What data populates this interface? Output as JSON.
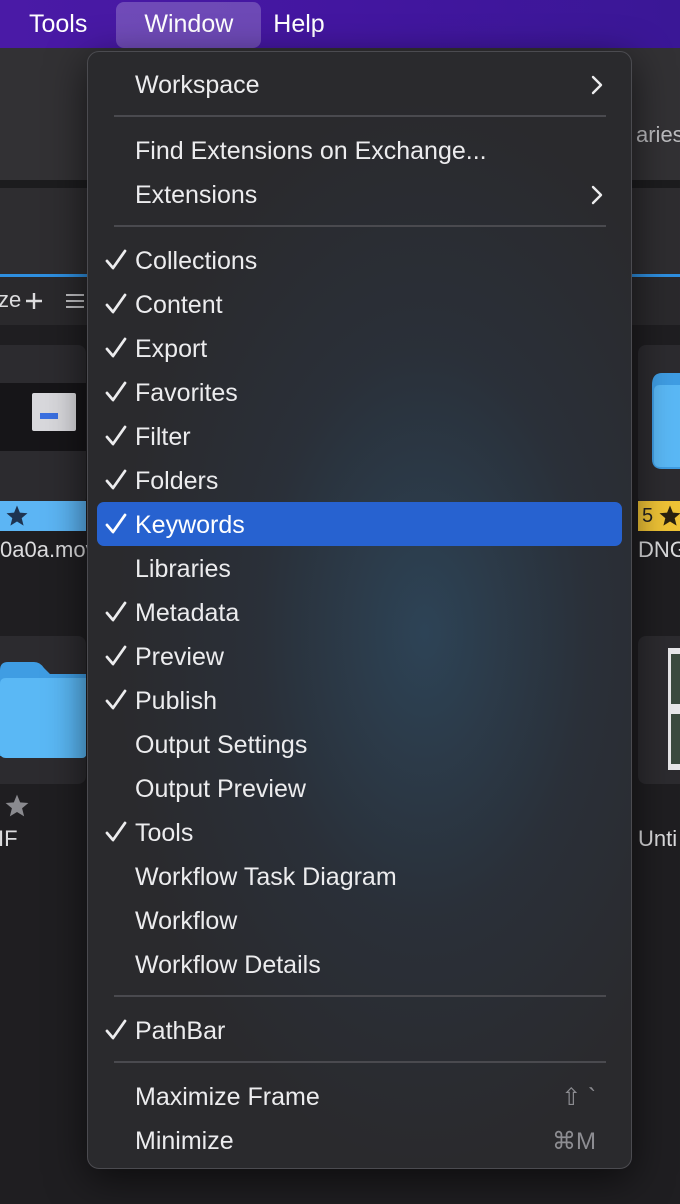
{
  "menubar": {
    "items": [
      "Tools",
      "Window",
      "Help"
    ],
    "active": "Window"
  },
  "background": {
    "toolbar_fragment": "aries",
    "panel_fragment": "ze",
    "file_left_top": "0a0a.mov",
    "file_left_bottom": "IF",
    "file_right_top": "DNG",
    "file_right_bottom": "Unti",
    "rating_right": "5"
  },
  "menu": {
    "workspace": "Workspace",
    "find_extensions": "Find Extensions on Exchange...",
    "extensions": "Extensions",
    "collections": "Collections",
    "content": "Content",
    "export": "Export",
    "favorites": "Favorites",
    "filter": "Filter",
    "folders": "Folders",
    "keywords": "Keywords",
    "libraries": "Libraries",
    "metadata": "Metadata",
    "preview": "Preview",
    "publish": "Publish",
    "output_settings": "Output Settings",
    "output_preview": "Output Preview",
    "tools": "Tools",
    "workflow_task_diagram": "Workflow Task Diagram",
    "workflow": "Workflow",
    "workflow_details": "Workflow Details",
    "pathbar": "PathBar",
    "maximize_frame": "Maximize Frame",
    "maximize_shortcut": "⇧ `",
    "minimize": "Minimize",
    "minimize_shortcut": "⌘M"
  },
  "checked_items": [
    "Collections",
    "Content",
    "Export",
    "Favorites",
    "Filter",
    "Folders",
    "Keywords",
    "Metadata",
    "Preview",
    "Publish",
    "Tools",
    "PathBar"
  ],
  "selected_item": "Keywords",
  "colors": {
    "menubar": "#4316a0",
    "highlight": "#2762d0",
    "rating_badge": "#f0c436",
    "folder": "#5ab8f5"
  }
}
